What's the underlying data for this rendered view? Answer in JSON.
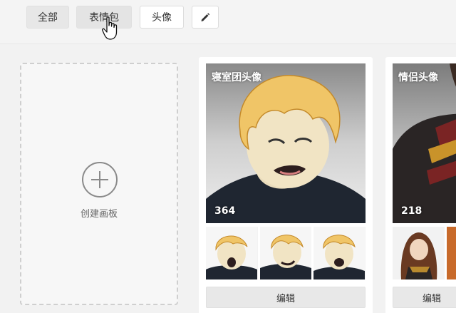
{
  "toolbar": {
    "all_label": "全部",
    "emoji_label": "表情包",
    "avatar_label": "头像",
    "edit_icon": "pencil-icon"
  },
  "add_board": {
    "label": "创建画板",
    "icon": "plus-circle-icon"
  },
  "boards": [
    {
      "title": "寝室团头像",
      "count": "364",
      "edit_label": "编辑"
    },
    {
      "title": "情侣头像",
      "count": "218",
      "edit_label": "编辑"
    }
  ],
  "colors": {
    "background": "#f2f2f2",
    "card": "#ffffff",
    "button_gray": "#e7e7e7",
    "text": "#333333"
  }
}
